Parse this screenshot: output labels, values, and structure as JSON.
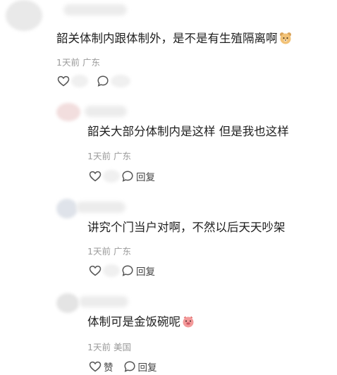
{
  "comments": [
    {
      "text": "韶关体制内跟体制外，是不是有生殖隔离啊",
      "time": "1天前",
      "location": "广东",
      "like_label": "",
      "reply_label": "",
      "emoji": "bear-emoji-icon"
    },
    {
      "text": "韶关大部分体制内是这样 但是我也这样",
      "time": "1天前",
      "location": "广东",
      "like_label": "",
      "reply_label": "回复"
    },
    {
      "text": "讲究个门当户对啊，不然以后天天吵架",
      "time": "1天前",
      "location": "广东",
      "like_label": "",
      "reply_label": "回复"
    },
    {
      "text": "体制可是金饭碗呢",
      "time": "1天前",
      "location": "美国",
      "like_label": "赞",
      "reply_label": "回复",
      "emoji": "pig-emoji-icon"
    }
  ],
  "colors": {
    "text": "#1f1f1f",
    "meta": "#9a9a9a",
    "icon": "#555555"
  }
}
